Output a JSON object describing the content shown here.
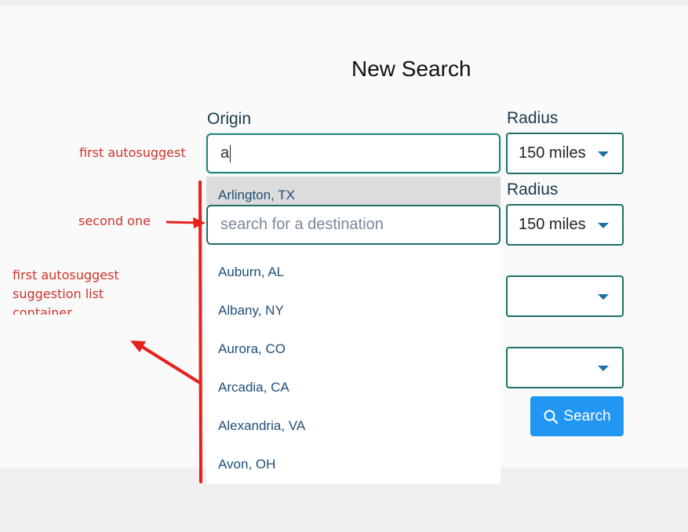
{
  "form": {
    "title": "New Search",
    "origin_label": "Origin",
    "origin_value": "a",
    "destination_placeholder": "search for a destination",
    "radius_label_1": "Radius",
    "radius_label_2": "Radius",
    "radius_value_1": "150 miles",
    "radius_value_2": "150 miles",
    "search_button": "Search"
  },
  "suggestions": {
    "highlighted": "Arlington, TX",
    "items": [
      "Auburn, AL",
      "Albany, NY",
      "Aurora, CO",
      "Arcadia, CA",
      "Alexandria, VA",
      "Avon, OH"
    ]
  },
  "annotations": {
    "first": "first autosuggest",
    "second": "second one",
    "container_line1": "first autosuggest",
    "container_line2": "suggestion list",
    "container_line3": "container"
  },
  "colors": {
    "accent": "#2196f3",
    "input_border": "#1e6f66",
    "annotation": "#d0322a"
  }
}
